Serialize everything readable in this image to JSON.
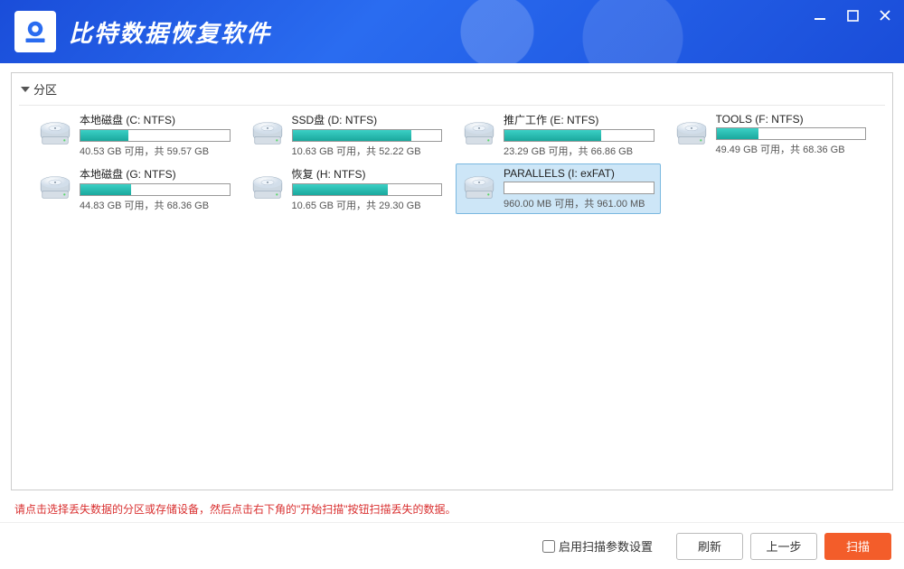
{
  "app": {
    "title": "比特数据恢复软件"
  },
  "section": {
    "label": "分区"
  },
  "drives": [
    {
      "name": "本地磁盘 (C: NTFS)",
      "free": "40.53 GB",
      "total": "59.57 GB",
      "used_pct": 32,
      "selected": false
    },
    {
      "name": "SSD盘 (D: NTFS)",
      "free": "10.63 GB",
      "total": "52.22 GB",
      "used_pct": 80,
      "selected": false
    },
    {
      "name": "推广工作 (E: NTFS)",
      "free": "23.29 GB",
      "total": "66.86 GB",
      "used_pct": 65,
      "selected": false
    },
    {
      "name": "TOOLS (F: NTFS)",
      "free": "49.49 GB",
      "total": "68.36 GB",
      "used_pct": 28,
      "selected": false
    },
    {
      "name": "本地磁盘 (G: NTFS)",
      "free": "44.83 GB",
      "total": "68.36 GB",
      "used_pct": 34,
      "selected": false
    },
    {
      "name": "恢复 (H: NTFS)",
      "free": "10.65 GB",
      "total": "29.30 GB",
      "used_pct": 64,
      "selected": false
    },
    {
      "name": "PARALLELS (I: exFAT)",
      "free": "960.00 MB",
      "total": "961.00 MB",
      "used_pct": 0.1,
      "selected": true
    }
  ],
  "status_template": {
    "avail": " 可用，共 "
  },
  "hint": "请点击选择丢失数据的分区或存储设备，然后点击右下角的\"开始扫描\"按钮扫描丢失的数据。",
  "footer": {
    "checkbox_label": "启用扫描参数设置",
    "refresh": "刷新",
    "prev": "上一步",
    "scan": "扫描"
  }
}
